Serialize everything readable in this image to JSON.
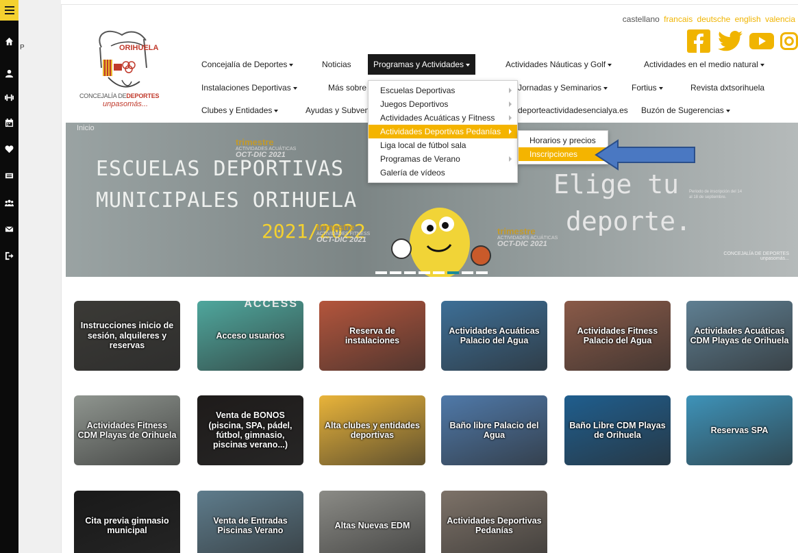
{
  "sidebar": {
    "menu_icon": "hamburger-icon",
    "items": [
      {
        "icon": "home-icon"
      },
      {
        "icon": "user-icon"
      },
      {
        "icon": "dumbbell-icon"
      },
      {
        "icon": "calendar-icon"
      },
      {
        "icon": "heart-pulse-icon"
      },
      {
        "icon": "ticket-icon"
      },
      {
        "icon": "users-icon"
      },
      {
        "icon": "envelope-icon"
      },
      {
        "icon": "logout-icon"
      }
    ]
  },
  "gap_letter": "P",
  "languages": [
    {
      "label": "castellano",
      "active": true
    },
    {
      "label": "francais",
      "active": false
    },
    {
      "label": "deutsche",
      "active": false
    },
    {
      "label": "english",
      "active": false
    },
    {
      "label": "valencia",
      "active": false
    }
  ],
  "social": [
    "facebook-icon",
    "twitter-icon",
    "youtube-icon",
    "instagram-icon"
  ],
  "logo": {
    "town": "ORIHUELA",
    "word_a": "CONCEJALÍA DE",
    "word_b": "DEPORTES",
    "tagline": "unpasomás..."
  },
  "nav": {
    "row1": [
      {
        "label": "Concejalía de Deportes",
        "caret": true
      },
      {
        "label": "Noticias",
        "caret": false
      },
      {
        "label": "Programas y Actividades",
        "caret": true,
        "active": true
      },
      {
        "label": "Actividades Náuticas y Golf",
        "caret": true
      },
      {
        "label": "Actividades en el medio natural",
        "caret": true
      }
    ],
    "row2": [
      {
        "label": "Instalaciones Deportivas",
        "caret": true
      },
      {
        "label": "Más sobre",
        "caret": false
      },
      {
        "label": "Jornadas y Seminarios",
        "caret": true
      },
      {
        "label": "Fortius",
        "caret": true
      },
      {
        "label": "Revista dxtsorihuela",
        "caret": false
      }
    ],
    "row3": [
      {
        "label": "Clubes y Entidades",
        "caret": true
      },
      {
        "label": "Ayudas y Subven",
        "caret": false
      },
      {
        "label": "deporteactividadesencialya.es",
        "caret": false
      },
      {
        "label": "Buzón de Sugerencias",
        "caret": true
      }
    ]
  },
  "dropdown": [
    {
      "label": "Escuelas Deportivas",
      "sub": true
    },
    {
      "label": "Juegos Deportivos",
      "sub": true
    },
    {
      "label": "Actividades Acuáticas y Fitness",
      "sub": true
    },
    {
      "label": "Actividades Deportivas Pedanías",
      "sub": true,
      "highlight": true
    },
    {
      "label": "Liga local de fútbol sala",
      "sub": false
    },
    {
      "label": "Programas de Verano",
      "sub": true
    },
    {
      "label": "Galería de vídeos",
      "sub": false
    }
  ],
  "submenu": [
    {
      "label": "Horarios y precios",
      "highlight": false
    },
    {
      "label": "Inscripciones",
      "highlight": true
    }
  ],
  "banner": {
    "breadcrumb": "Inicio",
    "line1": "ESCUELAS DEPORTIVAS",
    "line2": "MUNICIPALES ORIHUELA",
    "year": "2021/2022",
    "tri_word": "trimestre",
    "tri_sub": "ACTIVIDADES ACUÁTICAS",
    "tri_sub2": "ACTIVIDADES FITNESS",
    "tri_date": "OCT-DIC 2021",
    "elige": "Elige tu",
    "deporte": "deporte.",
    "period": "Periodo de inscripción del 14 al 18 de septiembre.",
    "footer_a": "CONCEJALÍA DE DEPORTES",
    "footer_b": "unpasomás...",
    "slides": 8,
    "active_slide": 5
  },
  "tiles": [
    {
      "label": "Instrucciones inicio de sesión, alquileres y reservas",
      "bg": "#3b3a36"
    },
    {
      "label": "Acceso usuarios",
      "bg": "#4fa79d",
      "overlay": "ACCESS"
    },
    {
      "label": "Reserva de instalaciones",
      "bg": "#b4553c"
    },
    {
      "label": "Actividades Acuáticas Palacio del Agua",
      "bg": "#3d6f97"
    },
    {
      "label": "Actividades Fitness Palacio del Agua",
      "bg": "#8a5a48"
    },
    {
      "label": "Actividades Acuáticas CDM Playas de Orihuela",
      "bg": "#5f7f92"
    },
    {
      "label": "Actividades Fitness CDM Playas de Orihuela",
      "bg": "#8f958f"
    },
    {
      "label": "Venta de BONOS (piscina, SPA, pádel, fútbol, gimnasio, piscinas verano...)",
      "bg": "#1e1b1a"
    },
    {
      "label": "Alta clubes y entidades deportivas",
      "bg": "#e9b43a"
    },
    {
      "label": "Baño libre Palacio del Agua",
      "bg": "#4f79a9"
    },
    {
      "label": "Baño Libre CDM Playas de Orihuela",
      "bg": "#1f5e8e"
    },
    {
      "label": "Reservas SPA",
      "bg": "#3e93b9"
    },
    {
      "label": "Cita previa gimnasio municipal",
      "bg": "#191919"
    },
    {
      "label": "Venta de Entradas Piscinas Verano",
      "bg": "#5e7c8c"
    },
    {
      "label": "Altas Nuevas EDM",
      "bg": "#8b8b86"
    },
    {
      "label": "Actividades Deportivas Pedanías",
      "bg": "#7d7268"
    }
  ]
}
